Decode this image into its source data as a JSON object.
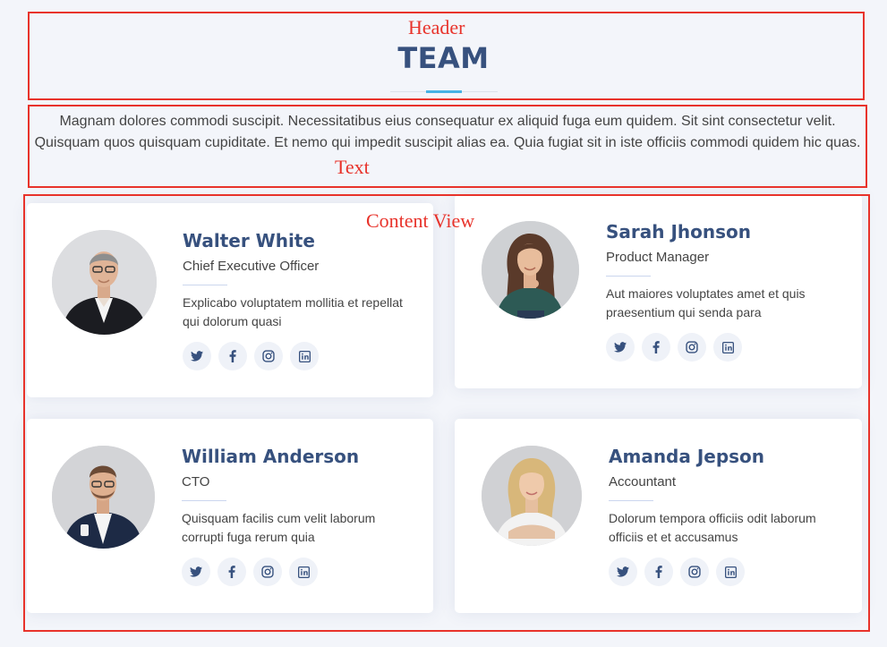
{
  "annotations": {
    "header": "Header",
    "text": "Text",
    "content_view": "Content View"
  },
  "section": {
    "title": "TEAM",
    "intro": "Magnam dolores commodi suscipit. Necessitatibus eius consequatur ex aliquid fuga eum quidem. Sit sint consectetur velit. Quisquam quos quisquam cupiditate. Et nemo qui impedit suscipit alias ea. Quia fugiat sit in iste officiis commodi quidem hic quas."
  },
  "members": [
    {
      "name": "Walter White",
      "role": "Chief Executive Officer",
      "description": "Explicabo voluptatem mollitia et repellat qui dolorum quasi",
      "social": [
        "twitter-icon",
        "facebook-icon",
        "instagram-icon",
        "linkedin-icon"
      ]
    },
    {
      "name": "Sarah Jhonson",
      "role": "Product Manager",
      "description": "Aut maiores voluptates amet et quis praesentium qui senda para",
      "social": [
        "twitter-icon",
        "facebook-icon",
        "instagram-icon",
        "linkedin-icon"
      ]
    },
    {
      "name": "William Anderson",
      "role": "CTO",
      "description": "Quisquam facilis cum velit laborum corrupti fuga rerum quia",
      "social": [
        "twitter-icon",
        "facebook-icon",
        "instagram-icon",
        "linkedin-icon"
      ]
    },
    {
      "name": "Amanda Jepson",
      "role": "Accountant",
      "description": "Dolorum tempora officiis odit laborum officiis et et accusamus",
      "social": [
        "twitter-icon",
        "facebook-icon",
        "instagram-icon",
        "linkedin-icon"
      ]
    }
  ],
  "colors": {
    "title": "#37517e",
    "accent": "#47b2e4",
    "annotation": "#e8332b",
    "background": "#f3f5fa"
  }
}
